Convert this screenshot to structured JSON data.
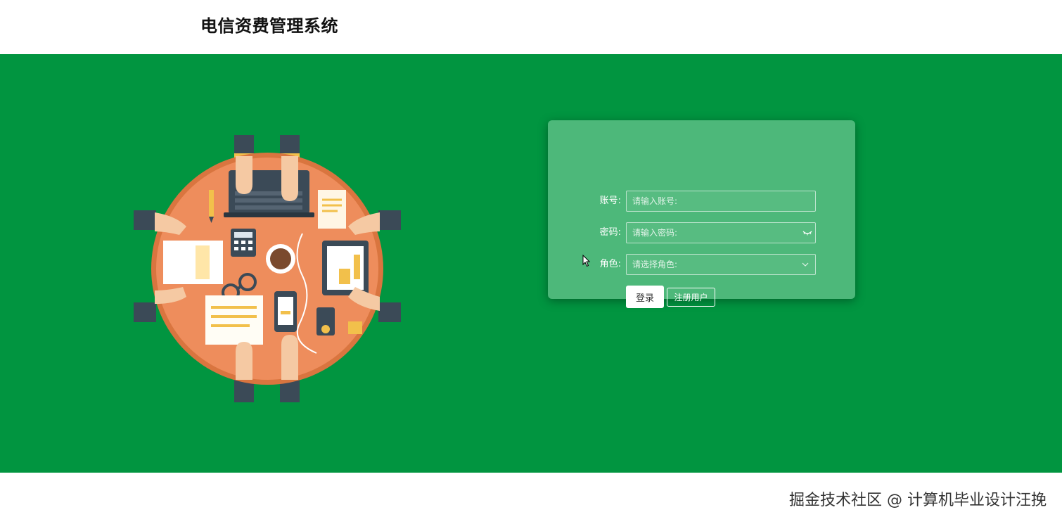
{
  "header": {
    "title": "电信资费管理系统"
  },
  "login": {
    "account_label": "账号:",
    "account_placeholder": "请输入账号:",
    "password_label": "密码:",
    "password_placeholder": "请输入密码:",
    "role_label": "角色:",
    "role_placeholder": "请选择角色:",
    "login_button": "登录",
    "register_button": "注册用户"
  },
  "watermark": "掘金技术社区 @ 计算机毕业设计汪挽",
  "colors": {
    "banner": "#019540",
    "card": "#4db87a",
    "table": "#ee8d5c"
  },
  "icons": [
    "eye-off-icon",
    "chevron-down-icon",
    "mouse-cursor-icon"
  ]
}
